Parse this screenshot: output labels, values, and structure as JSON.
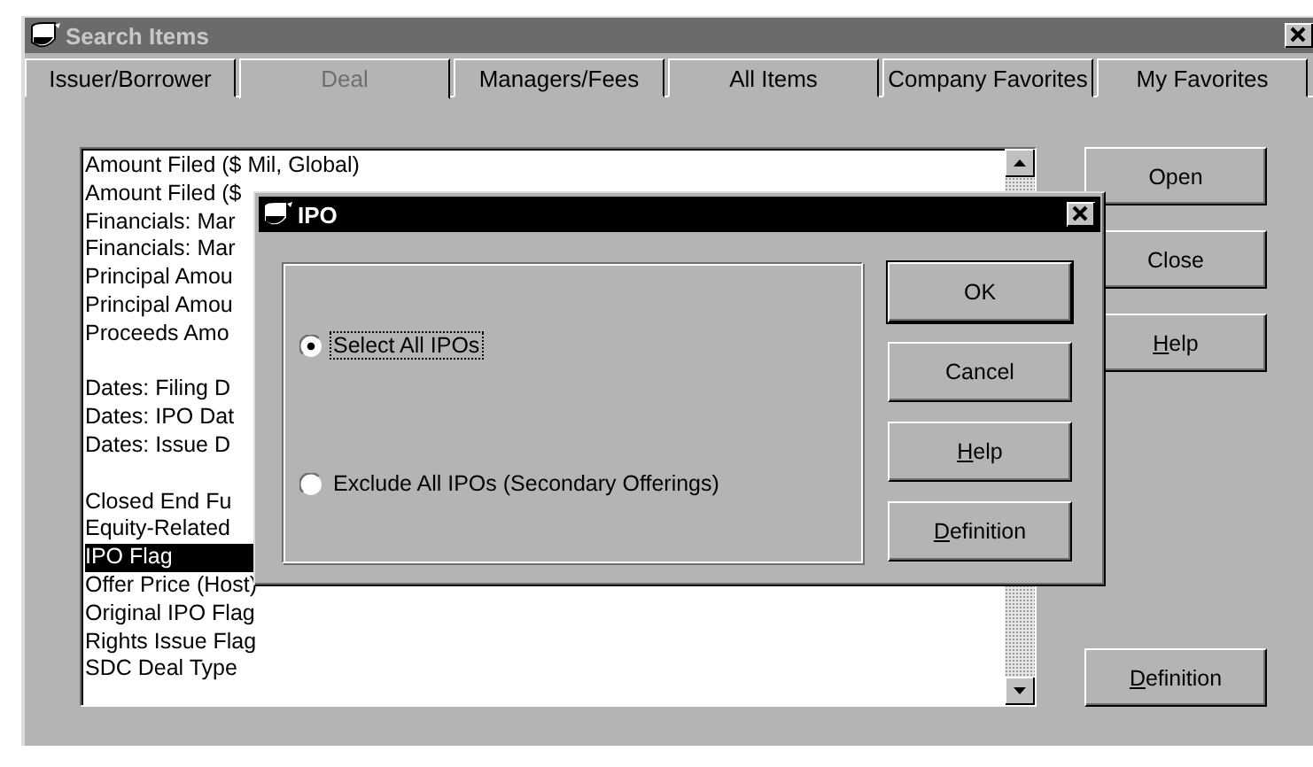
{
  "window": {
    "title": "Search Items"
  },
  "tabs": [
    {
      "label": "Issuer/Borrower",
      "selected": false
    },
    {
      "label": "Deal",
      "selected": true
    },
    {
      "label": "Managers/Fees",
      "selected": false
    },
    {
      "label": "All Items",
      "selected": false
    },
    {
      "label": "Company Favorites",
      "selected": false
    },
    {
      "label": "My Favorites",
      "selected": false
    }
  ],
  "list": {
    "items": [
      {
        "kind": "item",
        "text": "Amount Filed ($ Mil, Global)",
        "selected": false
      },
      {
        "kind": "item",
        "text": "Amount Filed ($",
        "selected": false
      },
      {
        "kind": "item",
        "text": "Financials: Mar",
        "selected": false
      },
      {
        "kind": "item",
        "text": "Financials: Mar",
        "selected": false
      },
      {
        "kind": "item",
        "text": "Principal Amou",
        "selected": false
      },
      {
        "kind": "item",
        "text": "Principal Amou",
        "selected": false
      },
      {
        "kind": "item",
        "text": "Proceeds Amo",
        "selected": false
      },
      {
        "kind": "gap"
      },
      {
        "kind": "item",
        "text": "Dates: Filing D",
        "selected": false
      },
      {
        "kind": "item",
        "text": "Dates: IPO Dat",
        "selected": false
      },
      {
        "kind": "item",
        "text": "Dates: Issue D",
        "selected": false
      },
      {
        "kind": "gap"
      },
      {
        "kind": "item",
        "text": "Closed End Fu",
        "selected": false
      },
      {
        "kind": "item",
        "text": "Equity-Related",
        "selected": false
      },
      {
        "kind": "item",
        "text": "IPO Flag",
        "selected": true
      },
      {
        "kind": "item",
        "text": "Offer Price (Host)",
        "selected": false
      },
      {
        "kind": "item",
        "text": "Original IPO Flag",
        "selected": false
      },
      {
        "kind": "item",
        "text": "Rights Issue Flag",
        "selected": false
      },
      {
        "kind": "item",
        "text": "SDC Deal Type",
        "selected": false
      }
    ]
  },
  "buttons": [
    {
      "label": "Open"
    },
    {
      "label": "Close"
    },
    {
      "key": "H",
      "rest": "elp"
    }
  ],
  "definition_button": {
    "key": "D",
    "rest": "efinition"
  },
  "dialog": {
    "title": "IPO",
    "options": [
      {
        "label": "Select All IPOs",
        "selected": true,
        "focused": true
      },
      {
        "label": "Exclude All IPOs (Secondary Offerings)",
        "selected": false,
        "focused": false
      }
    ],
    "buttons": [
      {
        "label": "OK",
        "default": true
      },
      {
        "label": "Cancel",
        "default": false
      },
      {
        "key": "H",
        "rest": "elp",
        "default": false
      },
      {
        "key": "D",
        "rest": "efinition",
        "default": false
      }
    ]
  }
}
